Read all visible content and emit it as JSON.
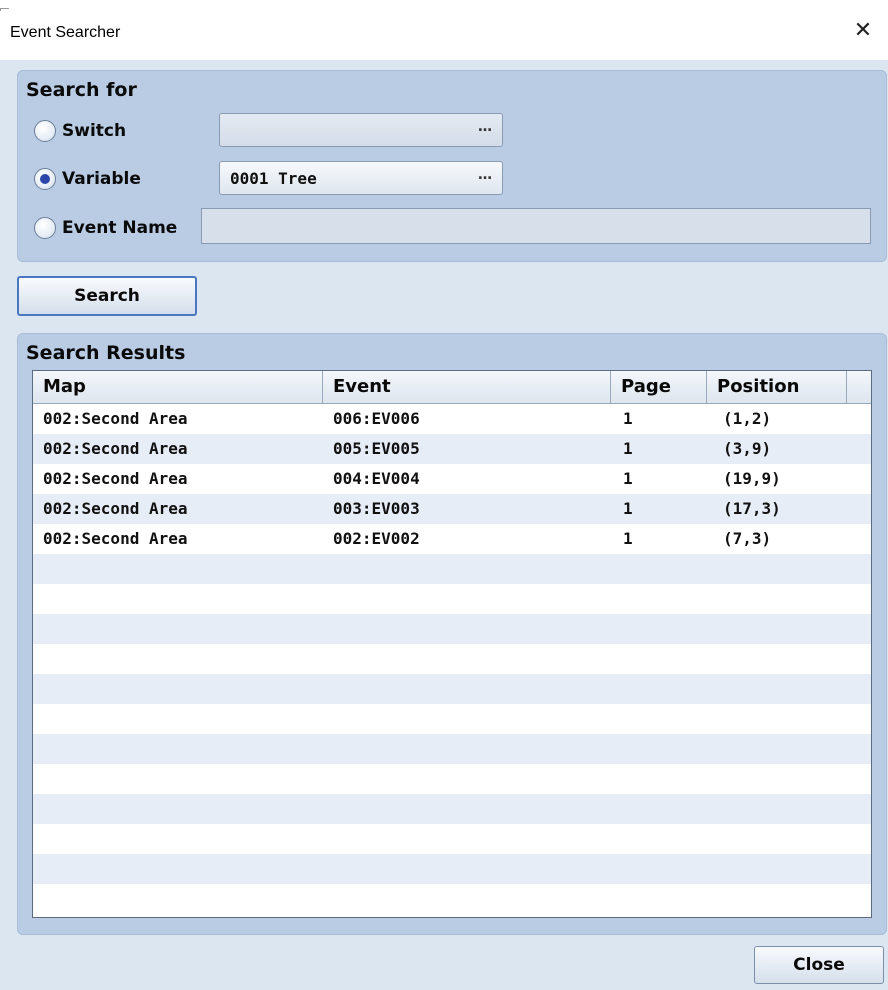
{
  "window": {
    "title": "Event Searcher",
    "close_glyph": "✕"
  },
  "search_for": {
    "title": "Search for",
    "options": {
      "switch": {
        "label": "Switch",
        "selected": false,
        "value": ""
      },
      "variable": {
        "label": "Variable",
        "selected": true,
        "value": "0001 Tree"
      },
      "event_name": {
        "label": "Event Name",
        "selected": false,
        "value": ""
      }
    },
    "ellipsis": "…"
  },
  "search_button": {
    "label": "Search"
  },
  "results": {
    "title": "Search Results",
    "columns": [
      "Map",
      "Event",
      "Page",
      "Position"
    ],
    "rows": [
      {
        "map": "002:Second Area",
        "event": "006:EV006",
        "page": "1",
        "position": "(1,2)"
      },
      {
        "map": "002:Second Area",
        "event": "005:EV005",
        "page": "1",
        "position": "(3,9)"
      },
      {
        "map": "002:Second Area",
        "event": "004:EV004",
        "page": "1",
        "position": "(19,9)"
      },
      {
        "map": "002:Second Area",
        "event": "003:EV003",
        "page": "1",
        "position": "(17,3)"
      },
      {
        "map": "002:Second Area",
        "event": "002:EV002",
        "page": "1",
        "position": "(7,3)"
      }
    ]
  },
  "close_button": {
    "label": "Close"
  },
  "colors": {
    "panel": "#b9cce4",
    "background": "#dce6f1",
    "radio_dot": "#2a46a8",
    "row_alt": "#e6edf6"
  }
}
